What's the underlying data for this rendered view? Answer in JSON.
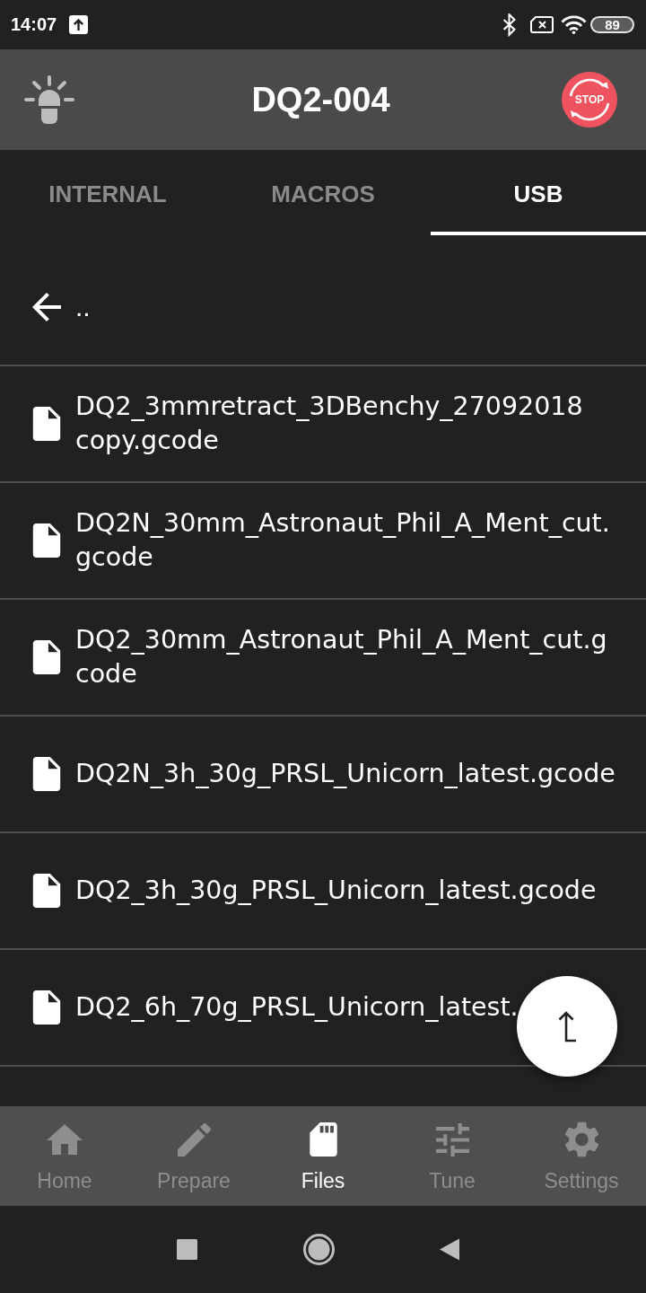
{
  "status_bar": {
    "time": "14:07",
    "battery": "89"
  },
  "app_bar": {
    "title": "DQ2-004",
    "stop_label": "STOP"
  },
  "tabs": [
    {
      "label": "INTERNAL",
      "selected": false
    },
    {
      "label": "MACROS",
      "selected": false
    },
    {
      "label": "USB",
      "selected": true
    }
  ],
  "parent_entry": {
    "label": ".."
  },
  "files": [
    {
      "name": "DQ2_3mmretract_3DBenchy_27092018 copy.gcode"
    },
    {
      "name": "DQ2N_30mm_Astronaut_Phil_A_Ment_cut.gcode"
    },
    {
      "name": "DQ2_30mm_Astronaut_Phil_A_Ment_cut.gcode"
    },
    {
      "name": "DQ2N_3h_30g_PRSL_Unicorn_latest.gcode"
    },
    {
      "name": "DQ2_3h_30g_PRSL_Unicorn_latest.gcode"
    },
    {
      "name": "DQ2_6h_70g_PRSL_Unicorn_latest."
    }
  ],
  "bottom_nav": [
    {
      "label": "Home",
      "selected": false
    },
    {
      "label": "Prepare",
      "selected": false
    },
    {
      "label": "Files",
      "selected": true
    },
    {
      "label": "Tune",
      "selected": false
    },
    {
      "label": "Settings",
      "selected": false
    }
  ]
}
